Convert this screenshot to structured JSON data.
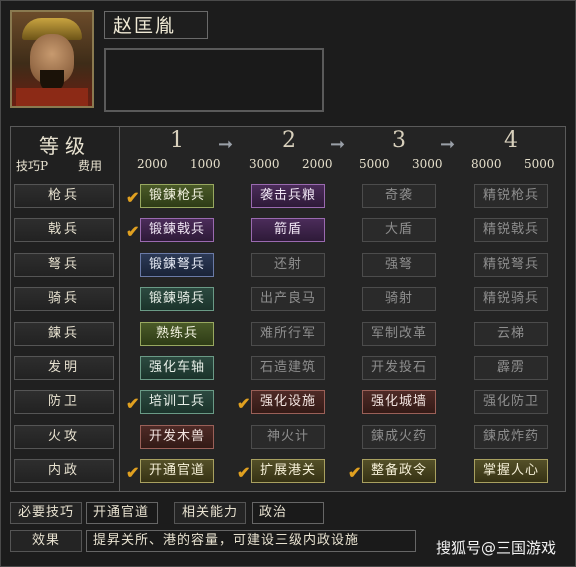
{
  "officer": {
    "name": "赵匡胤"
  },
  "header": {
    "title": "等级",
    "sub_left": "技巧P",
    "sub_right": "费用",
    "levels": [
      "1",
      "2",
      "3",
      "4"
    ],
    "costs": [
      {
        "a": "2000",
        "b": "1000"
      },
      {
        "a": "3000",
        "b": "2000"
      },
      {
        "a": "5000",
        "b": "3000"
      },
      {
        "a": "8000",
        "b": "5000"
      }
    ]
  },
  "rows": [
    {
      "label": "枪兵",
      "cells": [
        {
          "text": "锻鍊枪兵",
          "style": "green",
          "checked": true
        },
        {
          "text": "袭击兵粮",
          "style": "purple",
          "checked": false
        },
        {
          "text": "奇袭",
          "style": "gray",
          "checked": false
        },
        {
          "text": "精锐枪兵",
          "style": "gray",
          "checked": false
        }
      ]
    },
    {
      "label": "戟兵",
      "cells": [
        {
          "text": "锻鍊戟兵",
          "style": "purple",
          "checked": true
        },
        {
          "text": "箭盾",
          "style": "purple",
          "checked": false
        },
        {
          "text": "大盾",
          "style": "gray",
          "checked": false
        },
        {
          "text": "精锐戟兵",
          "style": "gray",
          "checked": false
        }
      ]
    },
    {
      "label": "弩兵",
      "cells": [
        {
          "text": "锻鍊弩兵",
          "style": "blue",
          "checked": false
        },
        {
          "text": "还射",
          "style": "gray",
          "checked": false
        },
        {
          "text": "强弩",
          "style": "gray",
          "checked": false
        },
        {
          "text": "精锐弩兵",
          "style": "gray",
          "checked": false
        }
      ]
    },
    {
      "label": "骑兵",
      "cells": [
        {
          "text": "锻鍊骑兵",
          "style": "teal",
          "checked": false
        },
        {
          "text": "出产良马",
          "style": "gray",
          "checked": false
        },
        {
          "text": "骑射",
          "style": "gray",
          "checked": false
        },
        {
          "text": "精锐骑兵",
          "style": "gray",
          "checked": false
        }
      ]
    },
    {
      "label": "鍊兵",
      "cells": [
        {
          "text": "熟练兵",
          "style": "green",
          "checked": false
        },
        {
          "text": "难所行军",
          "style": "gray",
          "checked": false
        },
        {
          "text": "军制改革",
          "style": "gray",
          "checked": false
        },
        {
          "text": "云梯",
          "style": "gray",
          "checked": false
        }
      ]
    },
    {
      "label": "发明",
      "cells": [
        {
          "text": "强化车轴",
          "style": "teal",
          "checked": false
        },
        {
          "text": "石造建筑",
          "style": "gray",
          "checked": false
        },
        {
          "text": "开发投石",
          "style": "gray",
          "checked": false
        },
        {
          "text": "霹雳",
          "style": "gray",
          "checked": false
        }
      ]
    },
    {
      "label": "防卫",
      "cells": [
        {
          "text": "培训工兵",
          "style": "teal",
          "checked": true
        },
        {
          "text": "强化设施",
          "style": "red",
          "checked": true
        },
        {
          "text": "强化城墙",
          "style": "red",
          "checked": false
        },
        {
          "text": "强化防卫",
          "style": "gray",
          "checked": false
        }
      ]
    },
    {
      "label": "火攻",
      "cells": [
        {
          "text": "开发木兽",
          "style": "red",
          "checked": false
        },
        {
          "text": "神火计",
          "style": "gray",
          "checked": false
        },
        {
          "text": "鍊成火药",
          "style": "gray",
          "checked": false
        },
        {
          "text": "鍊成炸药",
          "style": "gray",
          "checked": false
        }
      ]
    },
    {
      "label": "内政",
      "cells": [
        {
          "text": "开通官道",
          "style": "olive",
          "checked": true
        },
        {
          "text": "扩展港关",
          "style": "olive",
          "checked": true
        },
        {
          "text": "整备政令",
          "style": "olive",
          "checked": true
        },
        {
          "text": "掌握人心",
          "style": "olive",
          "checked": false
        }
      ]
    }
  ],
  "footer": {
    "required_label": "必要技巧",
    "required_value": "开通官道",
    "ability_label": "相关能力",
    "ability_value": "政治",
    "effect_label": "效果",
    "effect_value": "提昇关所、港的容量，可建设三级内政设施"
  },
  "watermark": "搜狐号@三国游戏",
  "check_glyph": "✔"
}
